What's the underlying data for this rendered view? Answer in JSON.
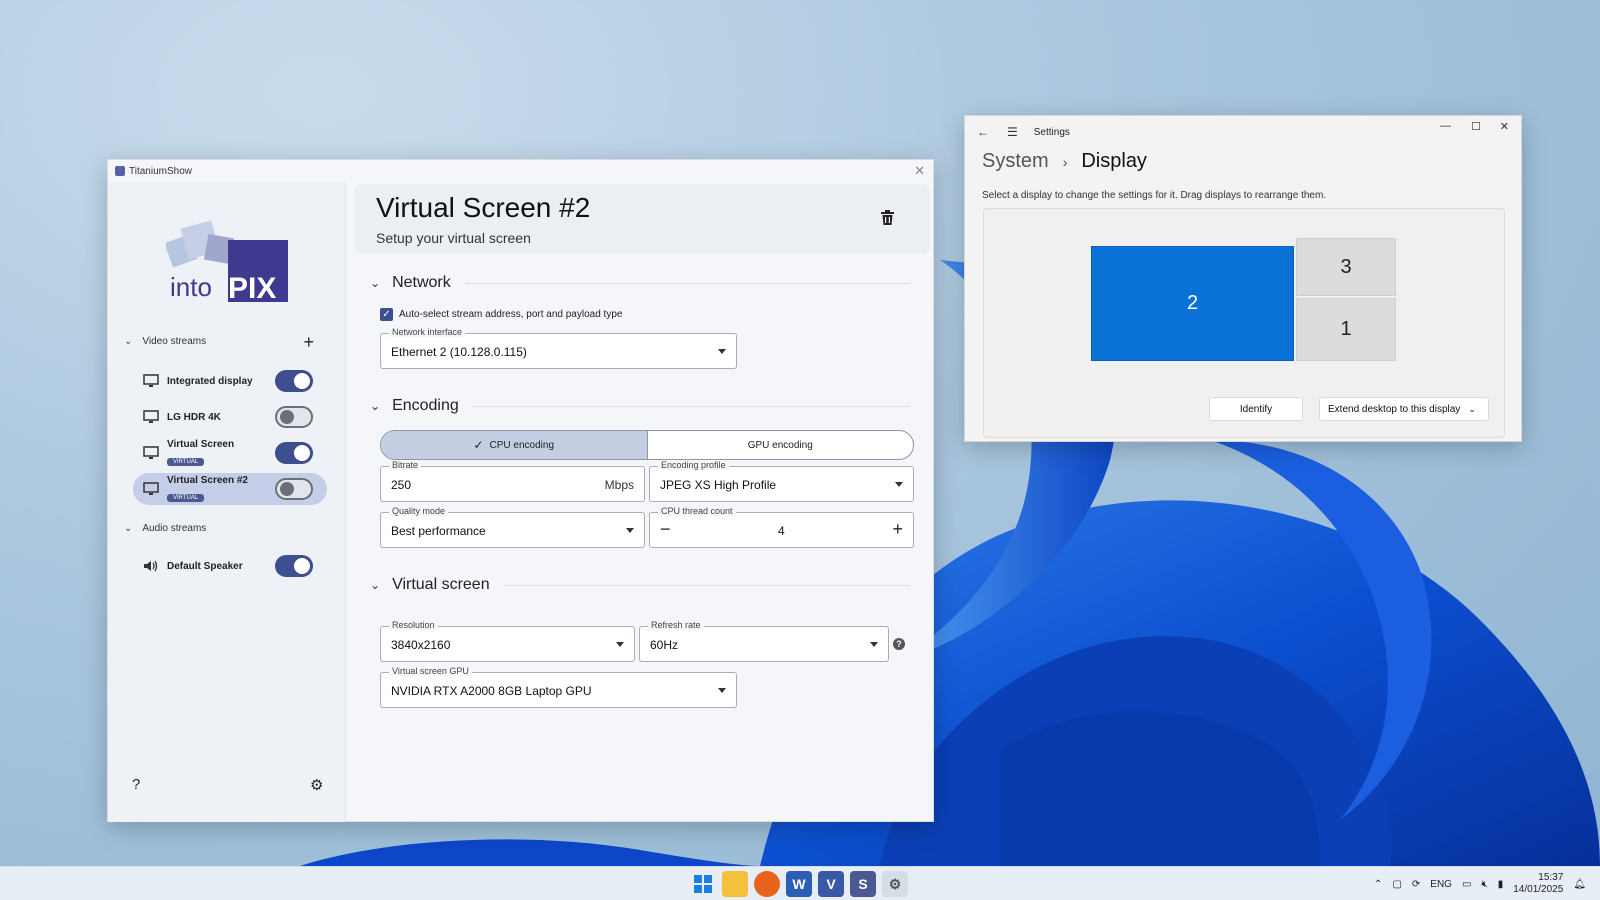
{
  "app": {
    "window_title": "TitaniumShow",
    "logo_text_a": "into",
    "logo_text_b": "PIX",
    "video_streams_label": "Video streams",
    "audio_streams_label": "Audio streams",
    "video_items": [
      {
        "label": "Integrated display",
        "badge": "",
        "enabled": true
      },
      {
        "label": "LG HDR 4K",
        "badge": "",
        "enabled": false
      },
      {
        "label": "Virtual Screen",
        "badge": "VIRTUAL",
        "enabled": true
      },
      {
        "label": "Virtual Screen #2",
        "badge": "VIRTUAL",
        "enabled": false
      }
    ],
    "audio_items": [
      {
        "label": "Default Speaker",
        "enabled": true
      }
    ],
    "help_glyph": "?",
    "page_title": "Virtual Screen #2",
    "page_subtitle": "Setup your virtual screen",
    "network": {
      "section": "Network",
      "auto_select_label": "Auto-select stream address, port and payload type",
      "interface_label": "Network interface",
      "interface_value": "Ethernet 2 (10.128.0.115)"
    },
    "encoding": {
      "section": "Encoding",
      "cpu_label": "CPU encoding",
      "gpu_label": "GPU encoding",
      "bitrate_label": "Bitrate",
      "bitrate_value": "250",
      "bitrate_unit": "Mbps",
      "profile_label": "Encoding profile",
      "profile_value": "JPEG XS High Profile",
      "quality_label": "Quality mode",
      "quality_value": "Best performance",
      "thread_label": "CPU thread count",
      "thread_value": "4"
    },
    "virtual_screen": {
      "section": "Virtual screen",
      "resolution_label": "Resolution",
      "resolution_value": "3840x2160",
      "refresh_label": "Refresh rate",
      "refresh_value": "60Hz",
      "gpu_label": "Virtual screen GPU",
      "gpu_value": "NVIDIA RTX A2000 8GB Laptop GPU"
    }
  },
  "settings": {
    "window_title": "Settings",
    "breadcrumb_parent": "System",
    "breadcrumb_current": "Display",
    "description": "Select a display to change the settings for it. Drag displays to rearrange them.",
    "monitors": [
      "2",
      "3",
      "1"
    ],
    "identify_label": "Identify",
    "extend_label": "Extend desktop to this display"
  },
  "taskbar": {
    "lang": "ENG",
    "time": "15:37",
    "date": "14/01/2025"
  },
  "colors": {
    "accent": "#3d4f8f",
    "windows_blue": "#0a72d6"
  }
}
